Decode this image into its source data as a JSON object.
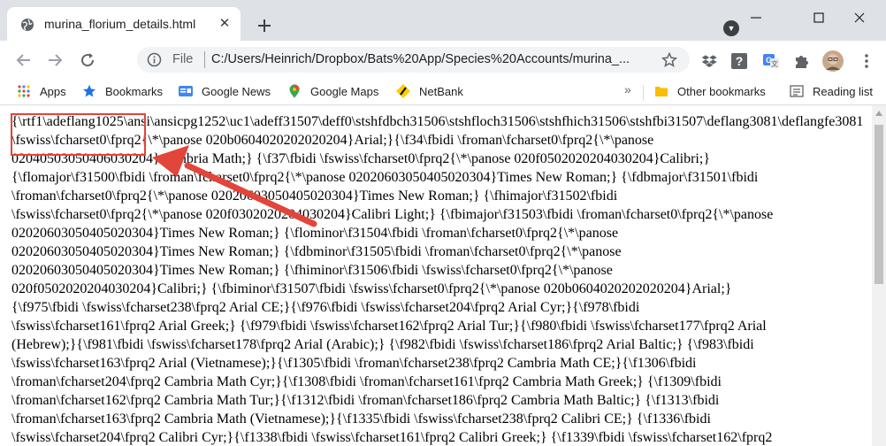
{
  "browser": {
    "tab_title": "murina_florium_details.html",
    "url_scheme": "File",
    "url": "C:/Users/Heinrich/Dropbox/Bats%20App/Species%20Accounts/murina_..."
  },
  "bookmarks": {
    "items": [
      {
        "label": "Apps",
        "icon": "apps-grid-icon"
      },
      {
        "label": "Bookmarks",
        "icon": "star-icon"
      },
      {
        "label": "Google News",
        "icon": "google-news-icon"
      },
      {
        "label": "Google Maps",
        "icon": "google-maps-icon"
      },
      {
        "label": "NetBank",
        "icon": "netbank-icon"
      }
    ],
    "more": "»",
    "other_bookmarks": "Other bookmarks",
    "reading_list": "Reading list"
  },
  "content": {
    "lines": [
      "{\\rtf1\\adeflang1025\\ansi\\ansicpg1252\\uc1\\adeff31507\\deff0\\stshfdbch31506\\stshfloch31506\\stshfhich31506\\stshfbi31507\\deflang3081\\deflangfe3081",
      "\\fswiss\\fcharset0\\fprq2{\\*\\panose 020b0604020202020204}Arial;}{\\f34\\fbidi \\froman\\fcharset0\\fprq2{\\*\\panose",
      "02040503050406030204}Cambria Math;} {\\f37\\fbidi \\fswiss\\fcharset0\\fprq2{\\*\\panose 020f0502020204030204}Calibri;}",
      "{\\flomajor\\f31500\\fbidi \\froman\\fcharset0\\fprq2{\\*\\panose 02020603050405020304}Times New Roman;} {\\fdbmajor\\f31501\\fbidi",
      "\\froman\\fcharset0\\fprq2{\\*\\panose 02020603050405020304}Times New Roman;} {\\fhimajor\\f31502\\fbidi",
      "\\fswiss\\fcharset0\\fprq2{\\*\\panose 020f0302020204030204}Calibri Light;} {\\fbimajor\\f31503\\fbidi \\froman\\fcharset0\\fprq2{\\*\\panose",
      "02020603050405020304}Times New Roman;} {\\flominor\\f31504\\fbidi \\froman\\fcharset0\\fprq2{\\*\\panose",
      "02020603050405020304}Times New Roman;} {\\fdbminor\\f31505\\fbidi \\froman\\fcharset0\\fprq2{\\*\\panose",
      "02020603050405020304}Times New Roman;} {\\fhiminor\\f31506\\fbidi \\fswiss\\fcharset0\\fprq2{\\*\\panose",
      "020f0502020204030204}Calibri;} {\\fbiminor\\f31507\\fbidi \\fswiss\\fcharset0\\fprq2{\\*\\panose 020b0604020202020204}Arial;}",
      "{\\f975\\fbidi \\fswiss\\fcharset238\\fprq2 Arial CE;}{\\f976\\fbidi \\fswiss\\fcharset204\\fprq2 Arial Cyr;}{\\f978\\fbidi",
      "\\fswiss\\fcharset161\\fprq2 Arial Greek;} {\\f979\\fbidi \\fswiss\\fcharset162\\fprq2 Arial Tur;}{\\f980\\fbidi \\fswiss\\fcharset177\\fprq2 Arial",
      "(Hebrew);}{\\f981\\fbidi \\fswiss\\fcharset178\\fprq2 Arial (Arabic);} {\\f982\\fbidi \\fswiss\\fcharset186\\fprq2 Arial Baltic;} {\\f983\\fbidi",
      "\\fswiss\\fcharset163\\fprq2 Arial (Vietnamese);}{\\f1305\\fbidi \\froman\\fcharset238\\fprq2 Cambria Math CE;}{\\f1306\\fbidi",
      "\\froman\\fcharset204\\fprq2 Cambria Math Cyr;}{\\f1308\\fbidi \\froman\\fcharset161\\fprq2 Cambria Math Greek;} {\\f1309\\fbidi",
      "\\froman\\fcharset162\\fprq2 Cambria Math Tur;}{\\f1312\\fbidi \\froman\\fcharset186\\fprq2 Cambria Math Baltic;} {\\f1313\\fbidi",
      "\\froman\\fcharset163\\fprq2 Cambria Math (Vietnamese);}{\\f1335\\fbidi \\fswiss\\fcharset238\\fprq2 Calibri CE;} {\\f1336\\fbidi",
      "\\fswiss\\fcharset204\\fprq2 Calibri Cyr;}{\\f1338\\fbidi \\fswiss\\fcharset161\\fprq2 Calibri Greek;} {\\f1339\\fbidi \\fswiss\\fcharset162\\fprq2"
    ]
  },
  "annotation": {
    "highlight_color": "#e2453a"
  }
}
